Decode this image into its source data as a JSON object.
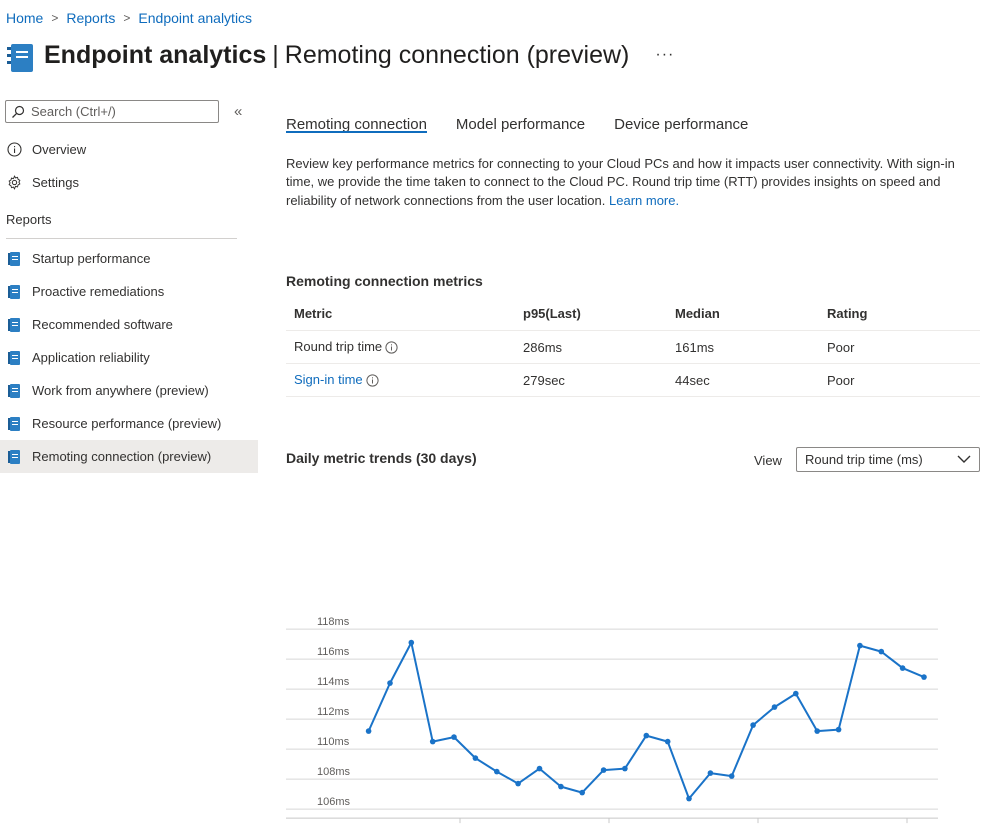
{
  "breadcrumb": {
    "home": "Home",
    "reports": "Reports",
    "current": "Endpoint analytics"
  },
  "header": {
    "title_bold": "Endpoint analytics",
    "separator": "|",
    "title_rest": "Remoting connection (preview)",
    "more": "···"
  },
  "sidebar": {
    "search_placeholder": "Search (Ctrl+/)",
    "collapse": "«",
    "overview": "Overview",
    "settings": "Settings",
    "reports_heading": "Reports",
    "reports": [
      "Startup performance",
      "Proactive remediations",
      "Recommended software",
      "Application reliability",
      "Work from anywhere (preview)",
      "Resource performance (preview)",
      "Remoting connection (preview)"
    ]
  },
  "tabs": [
    "Remoting connection",
    "Model performance",
    "Device performance"
  ],
  "description": {
    "text": "Review key performance metrics for connecting to your Cloud PCs and how it impacts user connectivity. With sign-in time, we provide the time taken to connect to the Cloud PC. Round trip time (RTT) provides insights on speed and reliability of network connections from the user location.",
    "link": "Learn more."
  },
  "metrics": {
    "title": "Remoting connection metrics",
    "headers": [
      "Metric",
      "p95(Last)",
      "Median",
      "Rating"
    ],
    "rows": [
      {
        "metric": "Round trip time",
        "p95": "286ms",
        "median": "161ms",
        "rating": "Poor"
      },
      {
        "metric": "Sign-in time",
        "p95": "279sec",
        "median": "44sec",
        "rating": "Poor"
      }
    ]
  },
  "trends": {
    "title": "Daily metric trends (30 days)",
    "view_label": "View",
    "view_selected": "Round trip time (ms)"
  },
  "colors": {
    "accent": "#0f6cbd",
    "line": "#1a73c8",
    "grid": "#d6d6d6",
    "selected_bg": "#edebe9"
  },
  "chart_data": {
    "type": "line",
    "y_ticks": [
      "118ms",
      "116ms",
      "114ms",
      "112ms",
      "110ms",
      "108ms",
      "106ms"
    ],
    "ylim": [
      105,
      118.5
    ],
    "series": [
      {
        "values": [
          110.7,
          113.9,
          116.6,
          110.0,
          110.3,
          108.9,
          108.0,
          107.2,
          108.2,
          107.0,
          106.6,
          108.1,
          108.2,
          110.4,
          110.0,
          106.2,
          107.9,
          107.7,
          111.1,
          112.3,
          113.2,
          110.7,
          110.8,
          116.4,
          116.0,
          114.9,
          114.3
        ]
      }
    ]
  }
}
